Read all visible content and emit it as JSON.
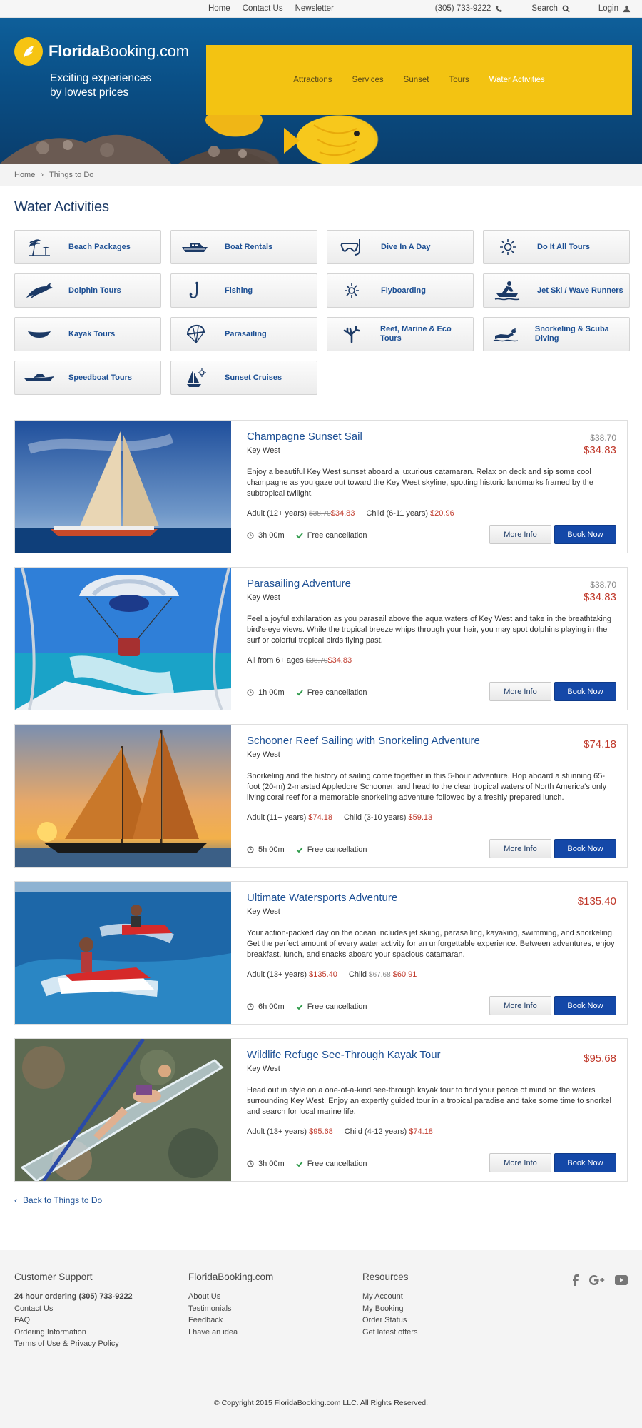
{
  "topbar": {
    "links": [
      "Home",
      "Contact Us",
      "Newsletter"
    ],
    "phone": "(305) 733-9222",
    "search": "Search",
    "login": "Login"
  },
  "brand": {
    "name_bold": "Florida",
    "name_rest": "Booking.com",
    "tagline_1": "Exciting experiences",
    "tagline_2": "by lowest prices"
  },
  "nav": [
    "Attractions",
    "Services",
    "Sunset",
    "Tours",
    "Water Activities"
  ],
  "breadcrumb": {
    "home": "Home",
    "current": "Things to Do"
  },
  "page_title": "Water Activities",
  "categories": [
    {
      "label": "Beach Packages",
      "icon": "palm-umbrella-icon"
    },
    {
      "label": "Boat Rentals",
      "icon": "boat-icon"
    },
    {
      "label": "Dive In A Day",
      "icon": "dive-mask-icon"
    },
    {
      "label": "Do It All Tours",
      "icon": "sun-icon"
    },
    {
      "label": "Dolphin Tours",
      "icon": "dolphin-icon"
    },
    {
      "label": "Fishing",
      "icon": "fish-hook-icon"
    },
    {
      "label": "Flyboarding",
      "icon": "flyboard-icon"
    },
    {
      "label": "Jet Ski / Wave Runners",
      "icon": "jet-ski-icon"
    },
    {
      "label": "Kayak Tours",
      "icon": "kayak-icon"
    },
    {
      "label": "Parasailing",
      "icon": "parasail-icon"
    },
    {
      "label": "Reef, Marine & Eco Tours",
      "icon": "coral-icon"
    },
    {
      "label": "Snorkeling & Scuba Diving",
      "icon": "snorkeler-icon"
    },
    {
      "label": "Speedboat Tours",
      "icon": "speedboat-icon"
    },
    {
      "label": "Sunset Cruises",
      "icon": "sailboat-sun-icon"
    }
  ],
  "tours": [
    {
      "title": "Champagne Sunset Sail",
      "location": "Key West",
      "old_price": "$38.70",
      "price": "$34.83",
      "description": "Enjoy a beautiful Key West sunset aboard a luxurious catamaran. Relax on deck and sip some cool champagne as you gaze out toward the Key West skyline, spotting historic landmarks framed by the subtropical twilight.",
      "rate_1_label": "Adult (12+ years)",
      "rate_1_old": "$38.70",
      "rate_1_price": "$34.83",
      "rate_2_label": "Child (6-11 years)",
      "rate_2_old": "",
      "rate_2_price": "$20.96",
      "duration": "3h 00m",
      "cancellation": "Free cancellation"
    },
    {
      "title": "Parasailing Adventure",
      "location": "Key West",
      "old_price": "$38.70",
      "price": "$34.83",
      "description": "Feel a joyful exhilaration as you parasail above the aqua waters of Key West and take in the breathtaking bird's-eye views. While the tropical breeze whips through your hair, you may spot dolphins playing in the surf or colorful tropical birds flying past.",
      "rate_1_label": "All from 6+ ages",
      "rate_1_old": "$38.70",
      "rate_1_price": "$34.83",
      "rate_2_label": "",
      "rate_2_old": "",
      "rate_2_price": "",
      "duration": "1h 00m",
      "cancellation": "Free cancellation"
    },
    {
      "title": "Schooner Reef Sailing with Snorkeling Adventure",
      "location": "Key West",
      "old_price": "",
      "price": "$74.18",
      "description": "Snorkeling and the history of sailing come together in this 5-hour adventure. Hop aboard a stunning 65-foot (20-m) 2-masted Appledore Schooner, and head to the clear tropical waters of North America's only living coral reef for a memorable snorkeling adventure followed by a freshly prepared lunch.",
      "rate_1_label": "Adult (11+ years)",
      "rate_1_old": "",
      "rate_1_price": "$74.18",
      "rate_2_label": "Child (3-10 years)",
      "rate_2_old": "",
      "rate_2_price": "$59.13",
      "duration": "5h 00m",
      "cancellation": "Free cancellation"
    },
    {
      "title": "Ultimate Watersports Adventure",
      "location": "Key West",
      "old_price": "",
      "price": "$135.40",
      "description": "Your action-packed day on the ocean includes jet skiing, parasailing, kayaking, swimming, and snorkeling. Get the perfect amount of every water activity for an unforgettable experience. Between adventures, enjoy breakfast, lunch, and snacks aboard your spacious catamaran.",
      "rate_1_label": "Adult (13+ years)",
      "rate_1_old": "",
      "rate_1_price": "$135.40",
      "rate_2_label": "Child",
      "rate_2_old": "$67.68",
      "rate_2_price": "$60.91",
      "duration": "6h 00m",
      "cancellation": "Free cancellation"
    },
    {
      "title": "Wildlife Refuge See-Through Kayak Tour",
      "location": "Key West",
      "old_price": "",
      "price": "$95.68",
      "description": "Head out in style on a one-of-a-kind see-through kayak tour to find your peace of mind on the waters surrounding Key West. Enjoy an expertly guided tour in a tropical paradise and take some time to snorkel and search for local marine life.",
      "rate_1_label": "Adult (13+ years)",
      "rate_1_old": "",
      "rate_1_price": "$95.68",
      "rate_2_label": "Child (4-12 years)",
      "rate_2_old": "",
      "rate_2_price": "$74.18",
      "duration": "3h 00m",
      "cancellation": "Free cancellation"
    }
  ],
  "buttons": {
    "more_info": "More Info",
    "book_now": "Book Now"
  },
  "back_link": "Back to Things to Do",
  "footer": {
    "support_title": "Customer Support",
    "support_strong": "24 hour ordering (305) 733-9222",
    "support_links": [
      "Contact Us",
      "FAQ",
      "Ordering Information",
      "Terms of Use & Privacy Policy"
    ],
    "brand_title": "FloridaBooking.com",
    "brand_links": [
      "About Us",
      "Testimonials",
      "Feedback",
      "I have an idea"
    ],
    "resources_title": "Resources",
    "resources_links": [
      "My Account",
      "My Booking",
      "Order Status",
      "Get latest offers"
    ],
    "copyright": "© Copyright 2015 FloridaBooking.com LLC. All Rights Reserved."
  },
  "colors": {
    "accent_blue": "#1448a8",
    "nav_yellow": "#f3c312",
    "price_red": "#c0392b",
    "title_blue": "#1c4f94"
  }
}
